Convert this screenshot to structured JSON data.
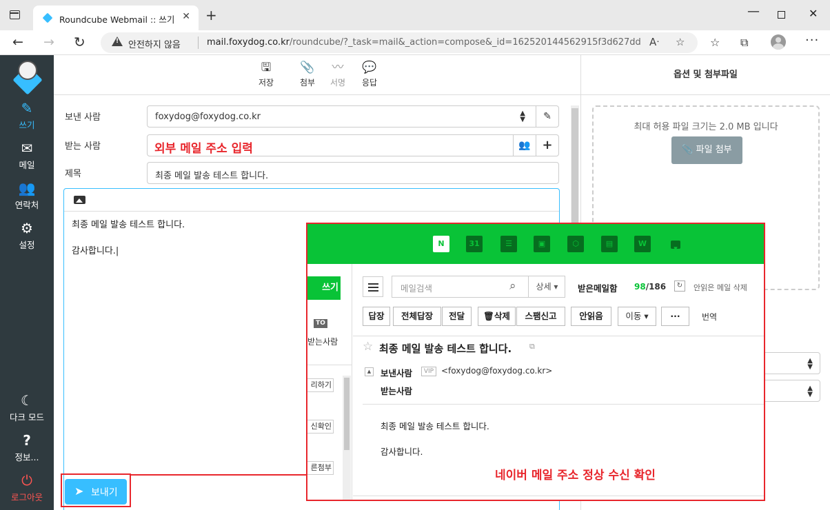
{
  "browser": {
    "tab_title": "Roundcube Webmail :: 쓰기",
    "security_warning": "안전하지 않음",
    "url_domain": "mail.foxydog.co.kr",
    "url_path": "/roundcube/?_task=mail&_action=compose&_id=162520144562915f3d627dd"
  },
  "sidebar": {
    "compose": "쓰기",
    "mail": "메일",
    "contacts": "연락처",
    "settings": "설정",
    "dark_mode": "다크 모드",
    "about": "정보...",
    "logout": "로그아웃"
  },
  "toolbar": {
    "save": "저장",
    "attach": "첨부",
    "signature": "서명",
    "responses": "응답"
  },
  "compose": {
    "from_label": "보낸 사람",
    "from_value": "foxydog@foxydog.co.kr",
    "to_label": "받는 사람",
    "to_value": "외부 메일 주소 입력",
    "subject_label": "제목",
    "subject_value": "최종 메일 발송 테스트 합니다.",
    "body_line1": "최종 메일 발송 테스트 합니다.",
    "body_line2": "감사합니다.|",
    "send": "보내기"
  },
  "options": {
    "title": "옵션 및 첨부파일",
    "max_size": "최대 허용 파일 크기는 2.0 MB 입니다",
    "attach_file": "파일 첨부"
  },
  "naver": {
    "write_btn": "쓰기",
    "to_badge": "TO",
    "to_me": "받는사람",
    "left_btn1": "리하기",
    "left_btn2": "신확인",
    "left_btn3": "른첨부",
    "search_placeholder": "메일검색",
    "search_option": "상세 ▾",
    "inbox": "받은메일함",
    "unread": "98",
    "total": "/186",
    "delete_read": "안읽은 메일 삭제",
    "actions": [
      "답장",
      "전체답장",
      "전달",
      "🗑삭제",
      "스팸신고",
      "안읽음",
      "이동 ▾",
      "···"
    ],
    "translate": "번역",
    "subject": "최종 메일 발송 테스트 합니다.",
    "from_label": "보낸사람",
    "vip": "VIP",
    "from_address": "<foxydog@foxydog.co.kr>",
    "to_label": "받는사람",
    "body_line1": "최종 메일 발송 테스트 합니다.",
    "body_line2": "감사합니다.",
    "caption": "네이버 메일 주소 정상 수신 확인"
  },
  "colors": {
    "accent": "#37beff",
    "sidebar": "#2f3a3f",
    "naver_green": "#09c337",
    "highlight": "#e8262c"
  }
}
